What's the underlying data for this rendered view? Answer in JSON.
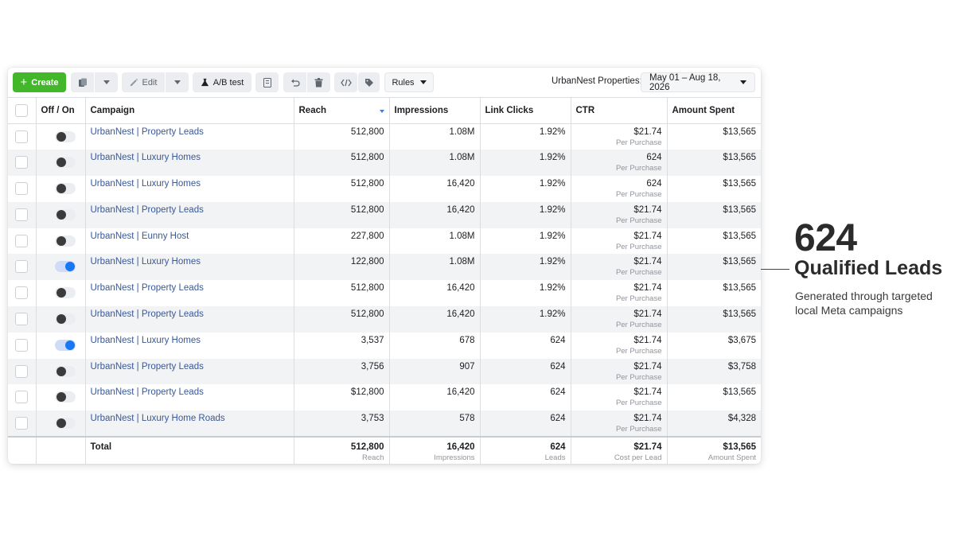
{
  "toolbar": {
    "create_label": "Create",
    "edit_label": "Edit",
    "ab_test_label": "A/B test",
    "rules_label": "Rules",
    "account_label": "UrbanNest Properties:",
    "date_range": "May 01 – Aug 18, 2026"
  },
  "columns": {
    "off_on": "Off / On",
    "campaign": "Campaign",
    "reach": "Reach",
    "impressions": "Impressions",
    "link_clicks": "Link Clicks",
    "ctr": "CTR",
    "amount_spent": "Amount Spent"
  },
  "rows": [
    {
      "on": false,
      "campaign": "UrbanNest | Property Leads",
      "reach": "512,800",
      "impressions": "1.08M",
      "clicks": "1.92%",
      "ctr": "$21.74",
      "ctr_sub": "Per Purchase",
      "spent": "$13,565"
    },
    {
      "on": false,
      "campaign": "UrbanNest | Luxury Homes",
      "reach": "512,800",
      "impressions": "1.08M",
      "clicks": "1.92%",
      "ctr": "624",
      "ctr_sub": "Per Purchase",
      "spent": "$13,565"
    },
    {
      "on": false,
      "campaign": "UrbanNest | Luxury Homes",
      "reach": "512,800",
      "impressions": "16,420",
      "clicks": "1.92%",
      "ctr": "624",
      "ctr_sub": "Per Purchase",
      "spent": "$13,565"
    },
    {
      "on": false,
      "campaign": "UrbanNest | Property Leads",
      "reach": "512,800",
      "impressions": "16,420",
      "clicks": "1.92%",
      "ctr": "$21.74",
      "ctr_sub": "Per Purchase",
      "spent": "$13,565"
    },
    {
      "on": false,
      "campaign": "UrbanNest | Eunny Host",
      "reach": "227,800",
      "impressions": "1.08M",
      "clicks": "1.92%",
      "ctr": "$21.74",
      "ctr_sub": "Per Purchase",
      "spent": "$13,565"
    },
    {
      "on": true,
      "campaign": "UrbanNest | Luxury Homes",
      "reach": "122,800",
      "impressions": "1.08M",
      "clicks": "1.92%",
      "ctr": "$21.74",
      "ctr_sub": "Per Purchase",
      "spent": "$13,565"
    },
    {
      "on": false,
      "campaign": "UrbanNest | Property Leads",
      "reach": "512,800",
      "impressions": "16,420",
      "clicks": "1.92%",
      "ctr": "$21.74",
      "ctr_sub": "Per Purchase",
      "spent": "$13,565"
    },
    {
      "on": false,
      "campaign": "UrbanNest | Property Leads",
      "reach": "512,800",
      "impressions": "16,420",
      "clicks": "1.92%",
      "ctr": "$21.74",
      "ctr_sub": "Per Purchase",
      "spent": "$13,565"
    },
    {
      "on": true,
      "campaign": "UrbanNest | Luxury Homes",
      "reach": "3,537",
      "impressions": "678",
      "clicks": "624",
      "ctr": "$21.74",
      "ctr_sub": "Per Purchase",
      "spent": "$3,675"
    },
    {
      "on": false,
      "campaign": "UrbanNest | Property Leads",
      "reach": "3,756",
      "impressions": "907",
      "clicks": "624",
      "ctr": "$21.74",
      "ctr_sub": "Per Purchase",
      "spent": "$3,758"
    },
    {
      "on": false,
      "campaign": "UrbanNest | Property Leads",
      "reach": "$12,800",
      "impressions": "16,420",
      "clicks": "624",
      "ctr": "$21.74",
      "ctr_sub": "Per Purchase",
      "spent": "$13,565"
    },
    {
      "on": false,
      "campaign": "UrbanNest | Luxury Home Roads",
      "reach": "3,753",
      "impressions": "578",
      "clicks": "624",
      "ctr": "$21.74",
      "ctr_sub": "Per Purchase",
      "spent": "$4,328"
    }
  ],
  "totals": {
    "label": "Total",
    "reach": "512,800",
    "reach_sub": "Reach",
    "impressions": "16,420",
    "impressions_sub": "Impressions",
    "clicks": "624",
    "clicks_sub": "Leads",
    "ctr": "$21.74",
    "ctr_sub": "Cost per Lead",
    "spent": "$13,565",
    "spent_sub": "Amount Spent"
  },
  "callout": {
    "number": "624",
    "label": "Qualified Leads",
    "description": "Generated through targeted local Meta campaigns"
  },
  "colors": {
    "create_green": "#42b72a",
    "link_blue": "#385898",
    "toggle_on": "#1877f2"
  }
}
